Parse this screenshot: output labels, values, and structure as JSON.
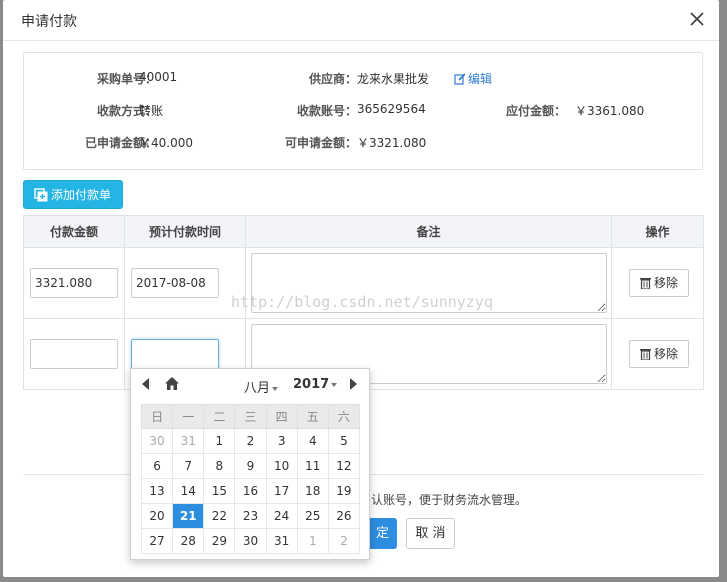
{
  "dialog": {
    "title": "申请付款"
  },
  "info": {
    "purchase_no_label": "采购单号：",
    "purchase_no": "40001",
    "supplier_label": "供应商：",
    "supplier": "龙来水果批发",
    "edit_label": "编辑",
    "pay_method_label": "收款方式：",
    "pay_method": "转账",
    "account_label": "收款账号：",
    "account": "365629564",
    "payable_label": "应付金额：",
    "payable": "￥3361.080",
    "applied_label": "已申请金额：",
    "applied": "￥40.000",
    "available_label": "可申请金额：",
    "available": "￥3321.080"
  },
  "add_button_label": "添加付款单",
  "table": {
    "headers": [
      "付款金额",
      "预计付款时间",
      "备注",
      "操作"
    ],
    "rows": [
      {
        "amount": "3321.080",
        "date": "2017-08-08",
        "remove_label": "移除"
      },
      {
        "amount": "",
        "date": "",
        "remove_label": "移除"
      }
    ]
  },
  "watermark": "http://blog.csdn.net/sunnyzyq",
  "footer": {
    "note": "认账号，便于财务流水管理。",
    "ok_label": "定",
    "cancel_label": "取 消"
  },
  "datepicker": {
    "month": "八月",
    "year": "2017",
    "weekdays": [
      "日",
      "一",
      "二",
      "三",
      "四",
      "五",
      "六"
    ],
    "weeks": [
      [
        "30",
        "31",
        "1",
        "2",
        "3",
        "4",
        "5"
      ],
      [
        "6",
        "7",
        "8",
        "9",
        "10",
        "11",
        "12"
      ],
      [
        "13",
        "14",
        "15",
        "16",
        "17",
        "18",
        "19"
      ],
      [
        "20",
        "21",
        "22",
        "23",
        "24",
        "25",
        "26"
      ],
      [
        "27",
        "28",
        "29",
        "30",
        "31",
        "1",
        "2"
      ]
    ],
    "selected": "21"
  },
  "colors": {
    "primary": "#2d8ddf",
    "add_button": "#25b5e5",
    "link": "#2f7bd0"
  }
}
